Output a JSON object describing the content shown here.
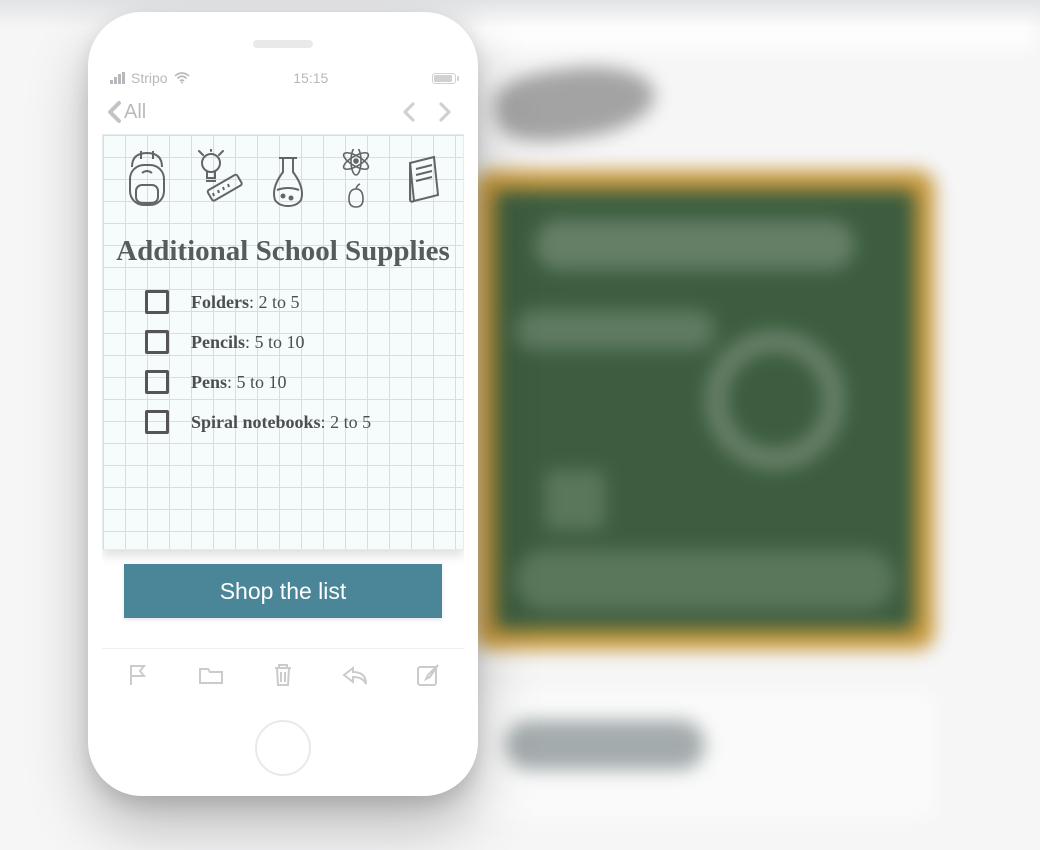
{
  "statusbar": {
    "carrier": "Stripo",
    "time": "15:15"
  },
  "mailnav": {
    "back_label": "All"
  },
  "note": {
    "title": "Additional School Supplies",
    "items": [
      {
        "label": "Folders",
        "qty": "2 to 5"
      },
      {
        "label": "Pencils",
        "qty": "5 to 10"
      },
      {
        "label": "Pens",
        "qty": "5 to 10"
      },
      {
        "label": "Spiral notebooks",
        "qty": "2 to 5"
      }
    ]
  },
  "cta": {
    "label": "Shop the list"
  },
  "colors": {
    "button": "#4a8697",
    "chalkboard": "#3c5d3f",
    "frame": "#c99a3c"
  }
}
